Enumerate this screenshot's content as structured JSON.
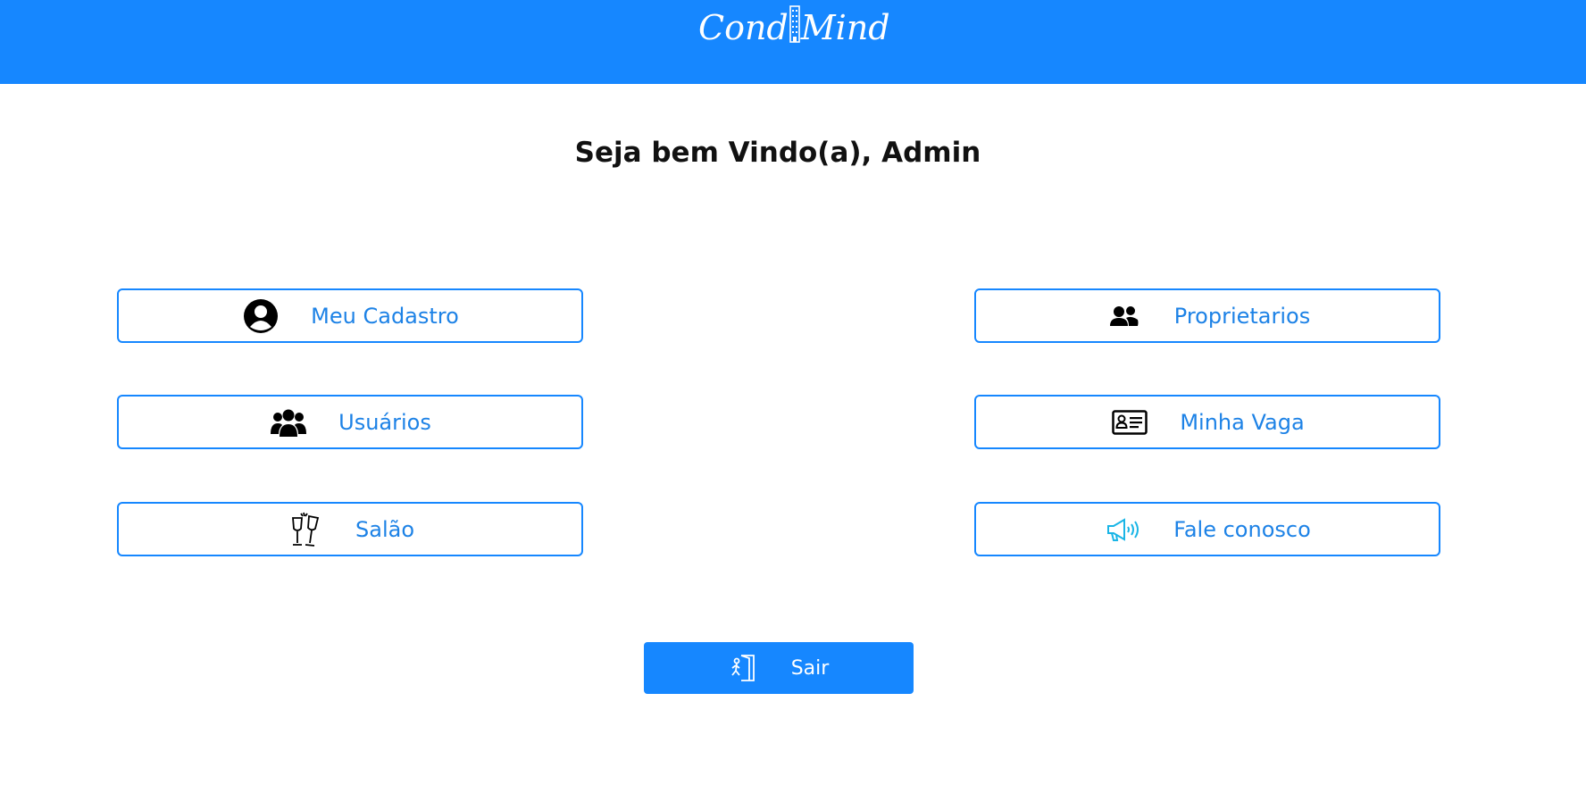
{
  "app": {
    "logo_text_left": "Cond",
    "logo_text_right": "Mind"
  },
  "welcome": {
    "title": "Seja bem Vindo(a), Admin"
  },
  "menu": {
    "meu_cadastro": {
      "label": "Meu Cadastro",
      "icon": "user-circle-icon"
    },
    "proprietarios": {
      "label": "Proprietarios",
      "icon": "user-friends-icon"
    },
    "usuarios": {
      "label": "Usuários",
      "icon": "users-group-icon"
    },
    "minha_vaga": {
      "label": "Minha Vaga",
      "icon": "id-card-icon"
    },
    "salao": {
      "label": "Salão",
      "icon": "champagne-glasses-icon"
    },
    "fale_conosco": {
      "label": "Fale conosco",
      "icon": "megaphone-icon"
    }
  },
  "logout": {
    "label": "Sair",
    "icon": "exit-door-icon"
  },
  "colors": {
    "primary": "#1687ff",
    "link_text": "#1d82e6",
    "white": "#ffffff"
  }
}
